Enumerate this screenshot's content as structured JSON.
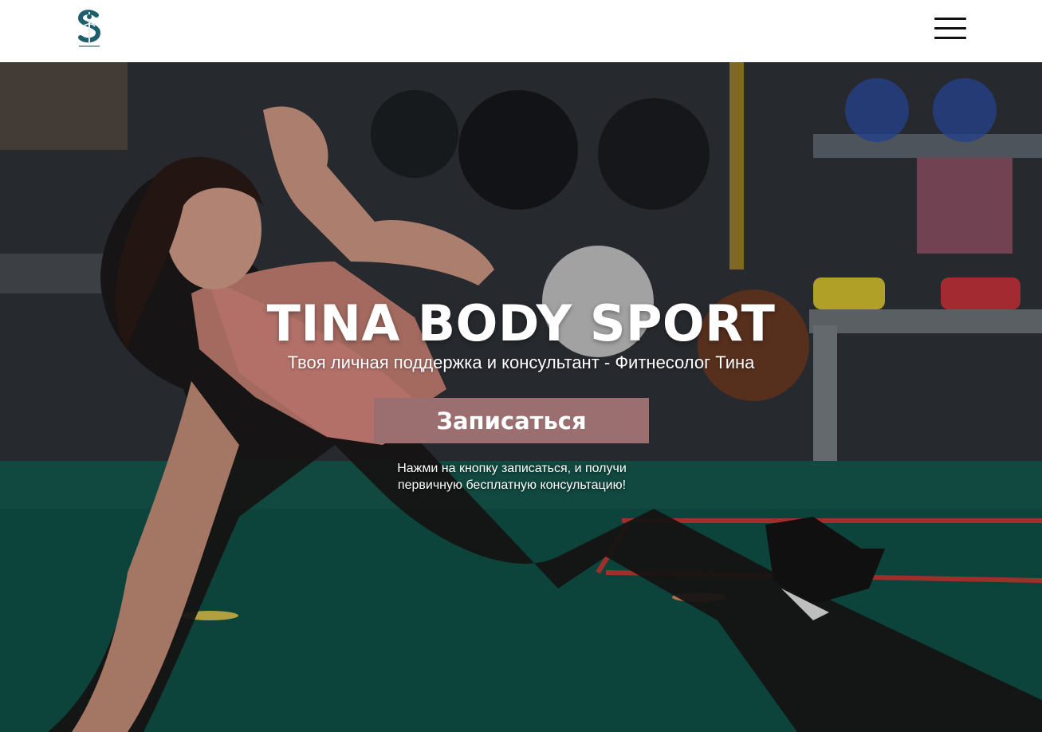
{
  "header": {
    "logo_alt": "Tina Body Sport logo",
    "logo_icon": "logo-s-monogram",
    "menu_icon": "hamburger-menu-icon"
  },
  "hero": {
    "background": "gym-fitness-photo",
    "title": "TINA BODY SPORT",
    "subtitle": "Твоя личная поддержка и консультант - Фитнесолог Тина",
    "cta_label": "Записаться",
    "cta_note": "Нажми на кнопку записаться, и получи первичную бесплатную консультацию!"
  },
  "colors": {
    "accent": "#9b6e70",
    "logo_teal": "#1e5f6b",
    "header_bg": "#ffffff",
    "text_on_hero": "#ffffff"
  }
}
